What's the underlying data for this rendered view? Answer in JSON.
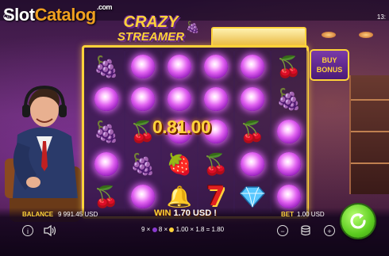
{
  "watermark": {
    "part1": "Slot",
    "part2": "Catalog",
    "suffix": ".com"
  },
  "header": {
    "menu_label": "Ot",
    "clock": "13:"
  },
  "game": {
    "title_line1": "CRAZY",
    "title_line2": "STREAMER"
  },
  "buy_bonus": {
    "line1": "BUY",
    "line2": "BONUS"
  },
  "grid": {
    "columns": [
      [
        "grapes",
        "orb",
        "grapes",
        "orb",
        "cherry"
      ],
      [
        "orb",
        "orb",
        "cherry",
        "grapes",
        "orb"
      ],
      [
        "orb",
        "orb",
        "orb",
        "strawberry",
        "bell"
      ],
      [
        "orb",
        "orb",
        "orb",
        "cherry",
        "seven"
      ],
      [
        "orb",
        "orb",
        "cherry",
        "orb",
        "diamond"
      ],
      [
        "cherry",
        "grapes",
        "orb",
        "orb",
        "orb"
      ]
    ],
    "multiplier_text": "0.8⁠1.00"
  },
  "balance": {
    "label": "BALANCE",
    "value": "9 991.45 USD"
  },
  "bet": {
    "label": "BET",
    "value": "1.00 USD"
  },
  "win": {
    "label": "WIN",
    "value": "1.70 USD !"
  },
  "win_formula": {
    "count_a": "9 ×",
    "count_b": "8 ×",
    "rest": "1.00 × 1.8 = 1.80"
  },
  "controls": {
    "info_icon": "info-icon",
    "sound_icon": "speaker-icon",
    "minus_icon": "minus-icon",
    "coins_icon": "coins-icon",
    "plus_icon": "plus-icon",
    "spin_icon": "spin-arrow-icon"
  },
  "colors": {
    "accent": "#ffd23a",
    "orb": "#e060f0",
    "spin": "#5ccc20"
  }
}
